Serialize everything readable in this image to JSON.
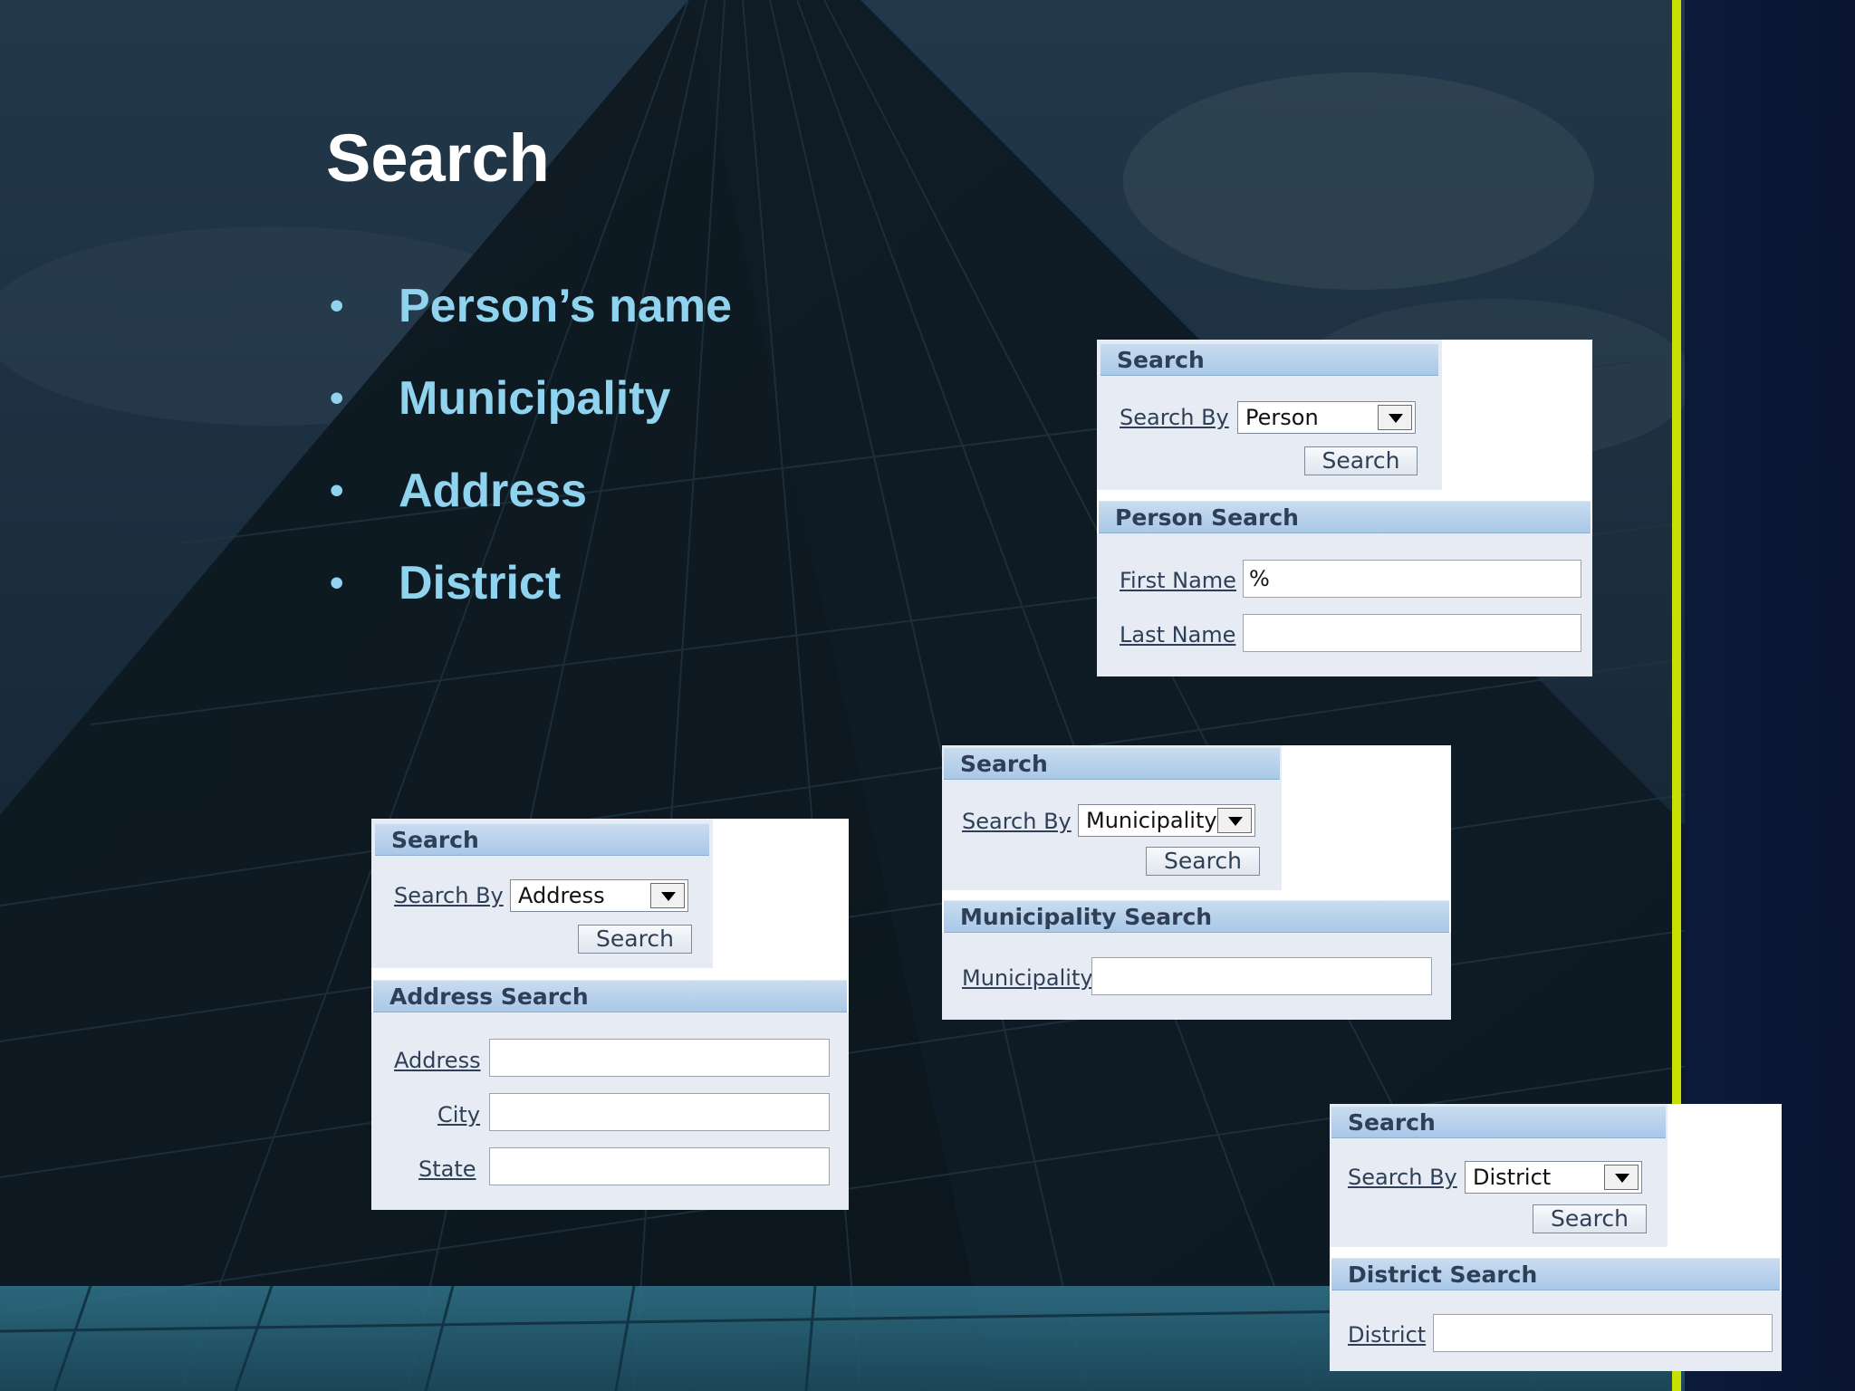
{
  "slide": {
    "title": "Search",
    "bullet_glyph": "•",
    "bullets": [
      "Person’s name",
      "Municipality",
      "Address",
      "District"
    ]
  },
  "panels": {
    "person": {
      "search_header": "Search",
      "search_by_label": "Search By",
      "search_by_value": "Person",
      "search_button": "Search",
      "section_header": "Person Search",
      "fields": [
        {
          "label": "First Name",
          "value": "%"
        },
        {
          "label": "Last Name",
          "value": ""
        }
      ]
    },
    "municipality": {
      "search_header": "Search",
      "search_by_label": "Search By",
      "search_by_value": "Municipality",
      "search_button": "Search",
      "section_header": "Municipality Search",
      "fields": [
        {
          "label": "Municipality",
          "value": ""
        }
      ]
    },
    "address": {
      "search_header": "Search",
      "search_by_label": "Search By",
      "search_by_value": "Address",
      "search_button": "Search",
      "section_header": "Address Search",
      "fields": [
        {
          "label": "Address",
          "value": ""
        },
        {
          "label": "City",
          "value": ""
        },
        {
          "label": "State",
          "value": ""
        }
      ]
    },
    "district": {
      "search_header": "Search",
      "search_by_label": "Search By",
      "search_by_value": "District",
      "search_button": "Search",
      "section_header": "District Search",
      "fields": [
        {
          "label": "District",
          "value": ""
        }
      ]
    }
  },
  "colors": {
    "accent_line": "#c8e000",
    "bullet_text": "#8fd3ee",
    "panel_header": "#a9c8e8"
  }
}
